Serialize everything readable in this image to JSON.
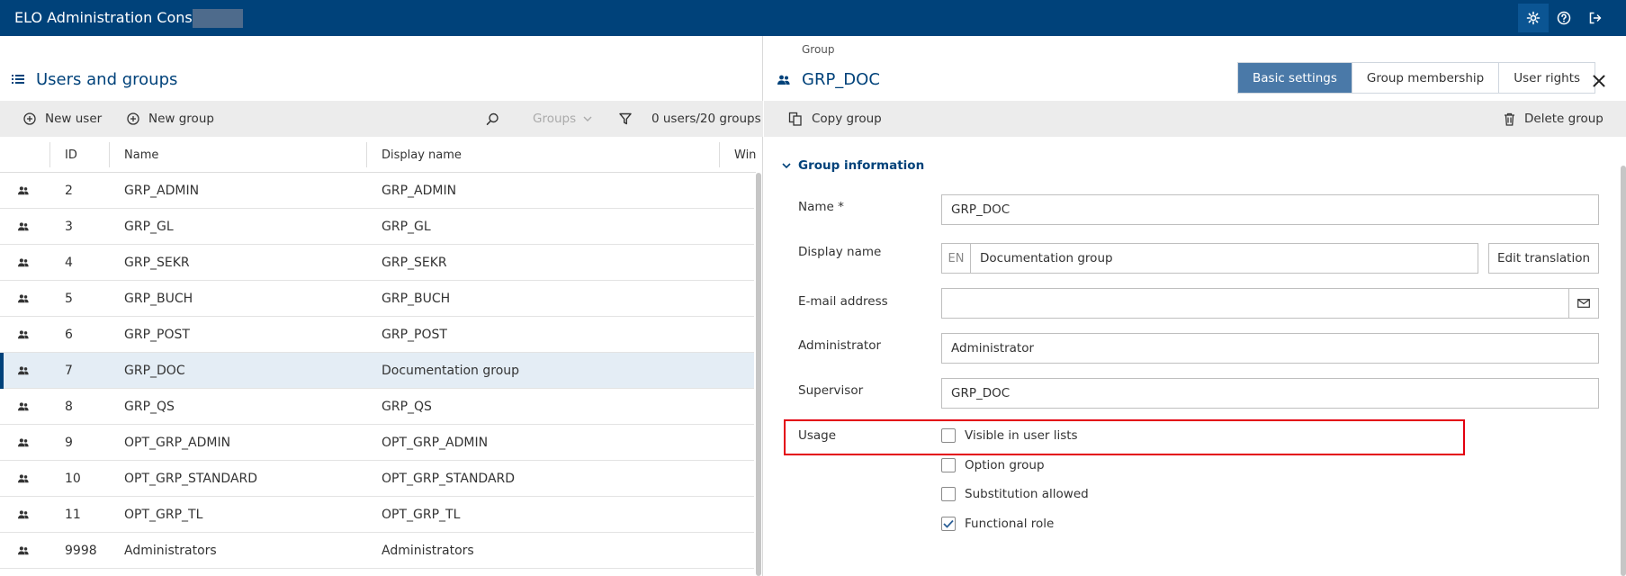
{
  "app": {
    "title": "ELO Administration Console"
  },
  "left": {
    "heading": "Users and groups",
    "toolbar": {
      "new_user": "New user",
      "new_group": "New group",
      "filter_select": "Groups",
      "count": "0 users/20 groups"
    },
    "columns": [
      "ID",
      "Name",
      "Display name",
      "Win"
    ],
    "rows": [
      {
        "id": "2",
        "name": "GRP_ADMIN",
        "display": "GRP_ADMIN"
      },
      {
        "id": "3",
        "name": "GRP_GL",
        "display": "GRP_GL"
      },
      {
        "id": "4",
        "name": "GRP_SEKR",
        "display": "GRP_SEKR"
      },
      {
        "id": "5",
        "name": "GRP_BUCH",
        "display": "GRP_BUCH"
      },
      {
        "id": "6",
        "name": "GRP_POST",
        "display": "GRP_POST"
      },
      {
        "id": "7",
        "name": "GRP_DOC",
        "display": "Documentation group"
      },
      {
        "id": "8",
        "name": "GRP_QS",
        "display": "GRP_QS"
      },
      {
        "id": "9",
        "name": "OPT_GRP_ADMIN",
        "display": "OPT_GRP_ADMIN"
      },
      {
        "id": "10",
        "name": "OPT_GRP_STANDARD",
        "display": "OPT_GRP_STANDARD"
      },
      {
        "id": "11",
        "name": "OPT_GRP_TL",
        "display": "OPT_GRP_TL"
      },
      {
        "id": "9998",
        "name": "Administrators",
        "display": "Administrators"
      }
    ],
    "selected_row": 5
  },
  "right": {
    "breadcrumb": "Group",
    "title": "GRP_DOC",
    "tabs": [
      "Basic settings",
      "Group membership",
      "User rights"
    ],
    "active_tab": 0,
    "toolbar": {
      "copy_group": "Copy group",
      "delete_group": "Delete group"
    },
    "section": "Group information",
    "form": {
      "name_label": "Name *",
      "name_value": "GRP_DOC",
      "display_label": "Display name",
      "display_lang": "EN",
      "display_value": "Documentation group",
      "edit_translation": "Edit translation",
      "email_label": "E-mail address",
      "email_value": "",
      "admin_label": "Administrator",
      "admin_value": "Administrator",
      "supervisor_label": "Supervisor",
      "supervisor_value": "GRP_DOC",
      "usage_label": "Usage"
    },
    "usage_options": [
      {
        "label": "Visible in user lists",
        "checked": false
      },
      {
        "label": "Option group",
        "checked": false
      },
      {
        "label": "Substitution allowed",
        "checked": false
      },
      {
        "label": "Functional role",
        "checked": true
      }
    ]
  },
  "colors": {
    "brand": "#00427a",
    "tab_active": "#4a79a8",
    "highlight": "#e3000f"
  }
}
